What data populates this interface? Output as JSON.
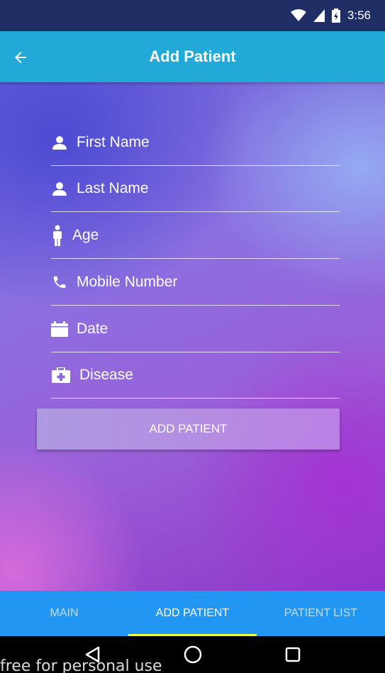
{
  "status_bar": {
    "time": "3:56",
    "icons": [
      "wifi-icon",
      "signal-icon",
      "battery-charging-icon"
    ]
  },
  "app_bar": {
    "title": "Add Patient",
    "back_icon": "arrow-back-icon"
  },
  "form": {
    "fields": [
      {
        "placeholder": "First Name",
        "icon": "person-icon"
      },
      {
        "placeholder": "Last Name",
        "icon": "person-icon"
      },
      {
        "placeholder": "Age",
        "icon": "man-icon"
      },
      {
        "placeholder": "Mobile Number",
        "icon": "phone-icon"
      },
      {
        "placeholder": "Date",
        "icon": "calendar-icon"
      },
      {
        "placeholder": "Disease",
        "icon": "medical-kit-icon"
      }
    ],
    "submit_label": "ADD PATIENT"
  },
  "tabs": [
    {
      "label": "MAIN",
      "active": false
    },
    {
      "label": "ADD PATIENT",
      "active": true
    },
    {
      "label": "PATIENT LIST",
      "active": false
    }
  ],
  "nav_bar": {
    "buttons": [
      "back-triangle-icon",
      "home-circle-icon",
      "recents-square-icon"
    ]
  },
  "watermark": "free for personal use",
  "colors": {
    "status_bar": "#1f2f66",
    "app_bar": "#22a9d8",
    "tab_bar": "#2196f3",
    "tab_indicator": "#eeff41"
  }
}
